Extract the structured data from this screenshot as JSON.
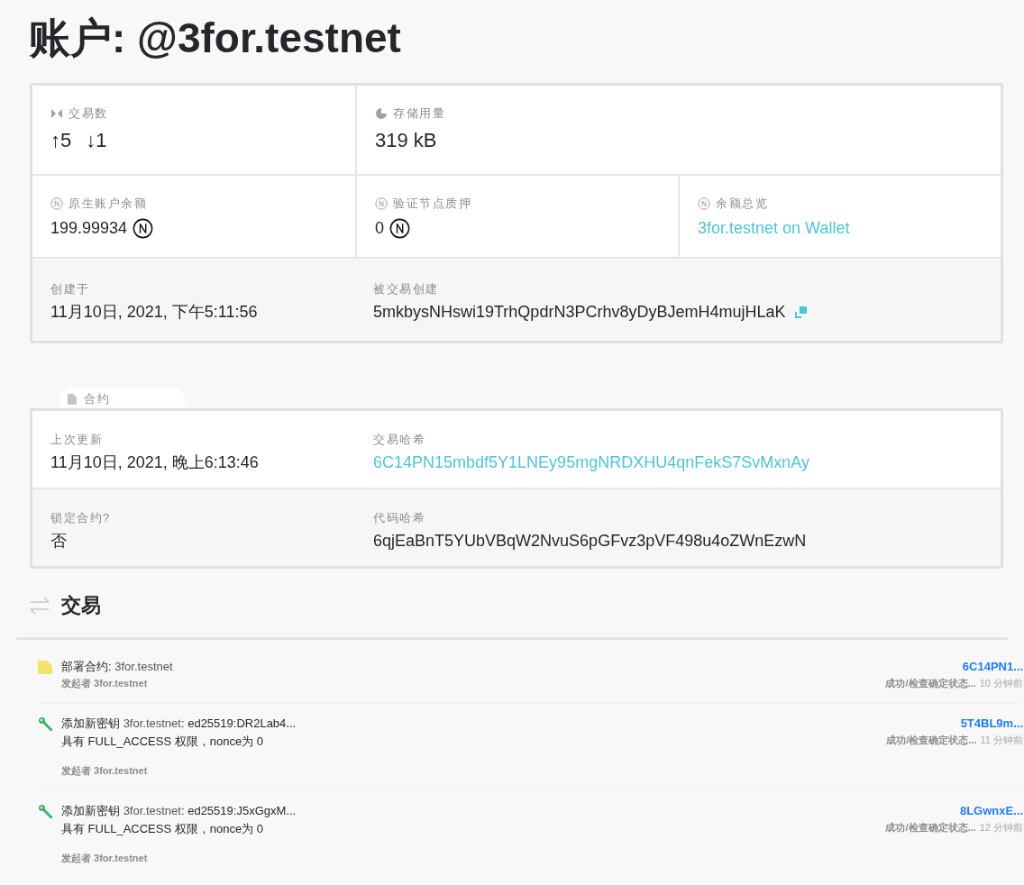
{
  "title": "账户: @3for.testnet",
  "account_card": {
    "rows": [
      {
        "cells": [
          {
            "label": "交易数",
            "kind": "counts",
            "values": [
              "↑5",
              "↓1"
            ]
          },
          {
            "label": "存储用量",
            "kind": "big",
            "value": "319 kB"
          }
        ]
      },
      {
        "cells": [
          {
            "label": "原生账户余额",
            "kind": "amount",
            "value": "199.99934"
          },
          {
            "label": "验证节点质押",
            "kind": "amount",
            "value": "0"
          },
          {
            "label": "余额总览",
            "kind": "wallet",
            "value": "3for.testnet on Wallet"
          }
        ]
      },
      {
        "cells": [
          {
            "label": "创建于",
            "kind": "text",
            "value": "11月10日, 2021, 下午5:11:56"
          },
          {
            "label": "被交易创建",
            "kind": "copy",
            "value": "5mkbysNHswi19TrhQpdrN3PCrhv8yDyBJemH4mujHLaK"
          }
        ]
      }
    ]
  },
  "contract_card": {
    "tab": "合约",
    "rows": [
      {
        "cells": [
          {
            "label": "上次更新",
            "kind": "text",
            "value": "11月10日, 2021, 晚上6:13:46"
          },
          {
            "label": "交易哈希",
            "kind": "link",
            "value": "6C14PN15mbdf5Y1LNEy95mgNRDXHU4qnFekS7SvMxnAy"
          }
        ]
      },
      {
        "cells": [
          {
            "label": "锁定合约?",
            "kind": "text",
            "value": "否"
          },
          {
            "label": "代码哈希",
            "kind": "text",
            "value": "6qjEaBnT5YUbVBqW2NvuS6pGFvz3pVF498u4oZWnEzwN"
          }
        ]
      }
    ]
  },
  "transactions": {
    "heading": "交易",
    "items": [
      {
        "kind": "deploy",
        "action": "部署合约:",
        "account": "3for.testnet",
        "sender": "发起者 3for.testnet",
        "hash": "6C14PN1...",
        "status": "成功/检查确定状态...",
        "time": "10 分钟前"
      },
      {
        "kind": "add_key",
        "action": "添加新密钥",
        "account": "3for.testnet",
        "detail": ": ed25519:DR2Lab4...",
        "permission": "具有 FULL_ACCESS 权限，nonce为 0",
        "sender": "发起者 3for.testnet",
        "hash": "5T4BL9m...",
        "status": "成功/检查确定状态...",
        "time": "11 分钟前"
      },
      {
        "kind": "add_key",
        "action": "添加新密钥",
        "account": "3for.testnet",
        "detail": ": ed25519:J5xGgxM...",
        "permission": "具有 FULL_ACCESS 权限，nonce为 0",
        "sender": "发起者 3for.testnet",
        "hash": "8LGwnxE...",
        "status": "成功/检查确定状态...",
        "time": "12 分钟前"
      }
    ]
  }
}
